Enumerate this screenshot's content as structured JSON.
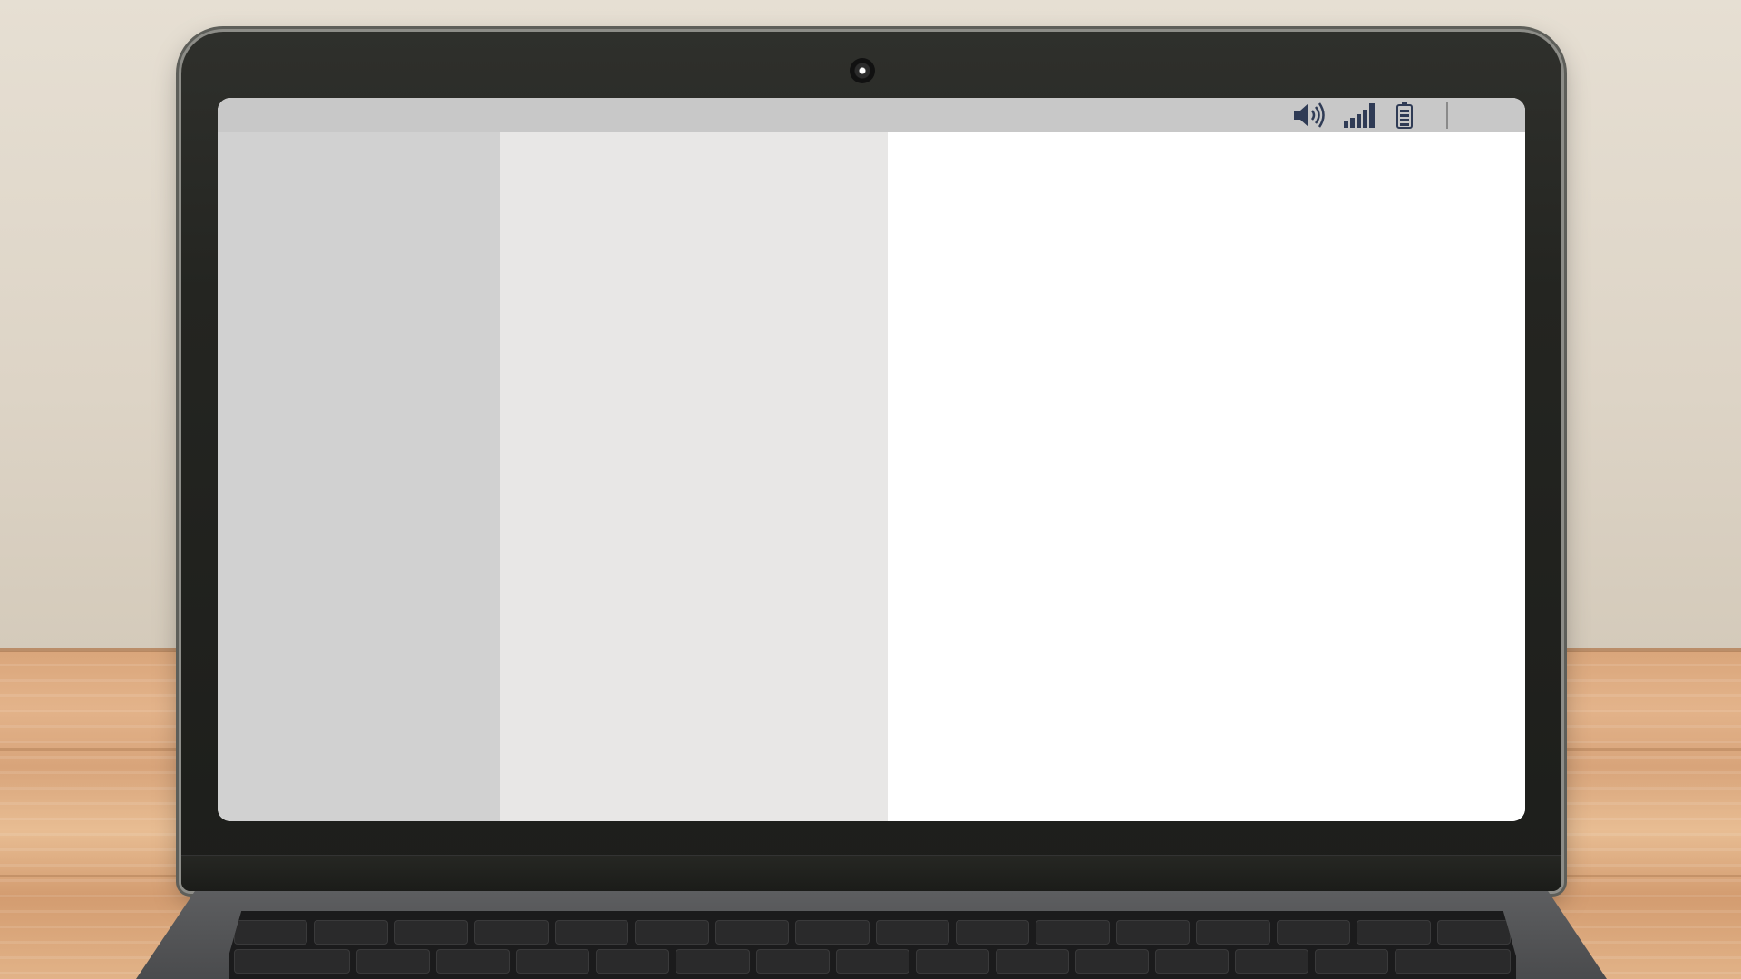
{
  "screen": {
    "status_icons": [
      {
        "name": "speaker-icon",
        "color": "#2f3b55"
      },
      {
        "name": "signal-strength-icon",
        "color": "#2f3b55"
      },
      {
        "name": "battery-icon",
        "color": "#2f3b55"
      }
    ],
    "panes": {
      "left_color": "#d1d1d1",
      "middle_color": "#e8e7e6",
      "right_color": "#ffffff"
    }
  },
  "colors": {
    "menubar": "#c8c8c8",
    "icon": "#2f3b55"
  }
}
